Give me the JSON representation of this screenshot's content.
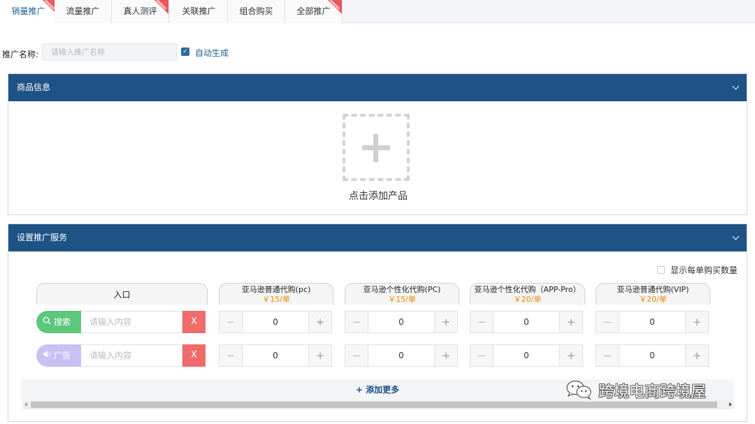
{
  "tabs": [
    {
      "label": "销量推广",
      "hot": true,
      "active": true
    },
    {
      "label": "流量推广",
      "hot": false,
      "active": false
    },
    {
      "label": "真人测评",
      "hot": true,
      "active": false
    },
    {
      "label": "关联推广",
      "hot": false,
      "active": false
    },
    {
      "label": "组合购买",
      "hot": false,
      "active": false
    },
    {
      "label": "全部推广",
      "hot": true,
      "active": false
    }
  ],
  "name_row": {
    "label": "推广名称:",
    "placeholder": "请输入推广名称",
    "auto_label": "自动生成",
    "auto_checked": true
  },
  "product_panel": {
    "title": "商品信息",
    "add_text": "点击添加产品"
  },
  "service_panel": {
    "title": "设置推广服务",
    "show_count_label": "显示每单购买数量",
    "entry_header": "入口",
    "columns": [
      {
        "title": "亚马逊普通代购(pc)",
        "price": "￥15/单"
      },
      {
        "title": "亚马逊个性化代购(PC)",
        "price": "￥15/单"
      },
      {
        "title": "亚马逊个性化代购（APP-Pro）",
        "price": "￥20/单"
      },
      {
        "title": "亚马逊普通代购(VIP)",
        "price": "￥20/单"
      }
    ],
    "rows": [
      {
        "tag": "搜索",
        "placeholder": "请输入内容",
        "remove": "X",
        "values": [
          "0",
          "0",
          "0",
          "0"
        ]
      },
      {
        "tag": "广告",
        "placeholder": "请输入内容",
        "remove": "X",
        "values": [
          "0",
          "0",
          "0",
          "0"
        ]
      }
    ],
    "add_more": "+ 添加更多"
  },
  "watermark": "跨境电商跨境屋",
  "colors": {
    "header_blue": "#1f5386",
    "accent_blue": "#225c8e",
    "hot_red": "#e9565b",
    "search_green": "#5dc77d",
    "ad_purple": "#c9c1f4",
    "remove_red": "#f06b6b",
    "price_orange": "#f08a00"
  }
}
